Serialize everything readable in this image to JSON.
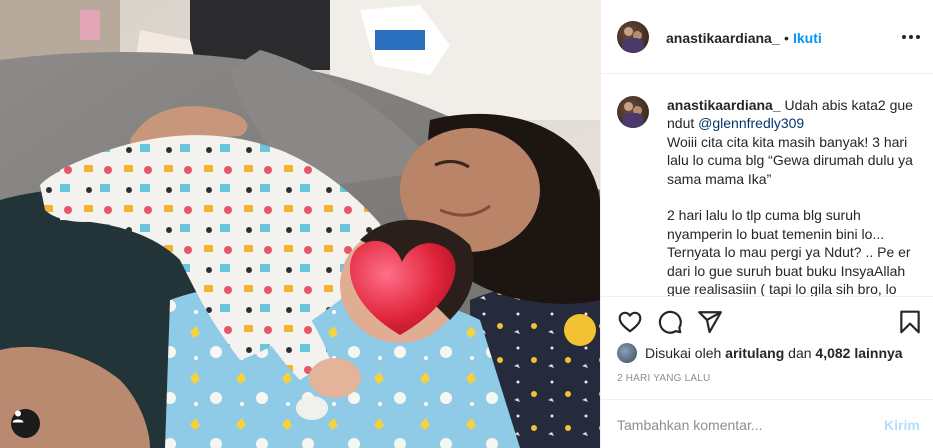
{
  "post": {
    "username": "anastikaardiana_",
    "separator": "•",
    "follow_label": "Ikuti"
  },
  "caption": {
    "username": "anastikaardiana_",
    "text_start": " Udah abis kata2 gue ndut ",
    "mention": "@glennfredly309",
    "text_rest": "\nWoiii cita cita kita masih banyak! 3 hari lalu lo cuma blg “Gewa dirumah dulu ya sama mama Ika”\n\n2 hari lalu lo tlp cuma blg suruh nyamperin lo buat temenin bini lo... Ternyata lo mau pergi ya Ndut? .. Pe er dari lo gue suruh buat buku InsyaAllah gue realisasiin ( tapi lo gila sih bro, lo"
  },
  "likes": {
    "prefix": "Disukai oleh",
    "user": "aritulang",
    "conjunction": "dan",
    "count": "4,082 lainnya"
  },
  "timestamp": "2 HARI YANG LALU",
  "comment_box": {
    "placeholder": "Tambahkan komentar...",
    "post_label": "Kirim"
  },
  "icons": [
    "user-tag-icon",
    "more-options-icon",
    "heart-icon",
    "comment-icon",
    "share-icon",
    "bookmark-icon"
  ],
  "colors": {
    "link_blue": "#0095f6",
    "mention_blue": "#00376b",
    "muted_text": "#8e8e8e",
    "disabled_post": "#b3dffc",
    "heart_sticker": "#e0253a"
  }
}
